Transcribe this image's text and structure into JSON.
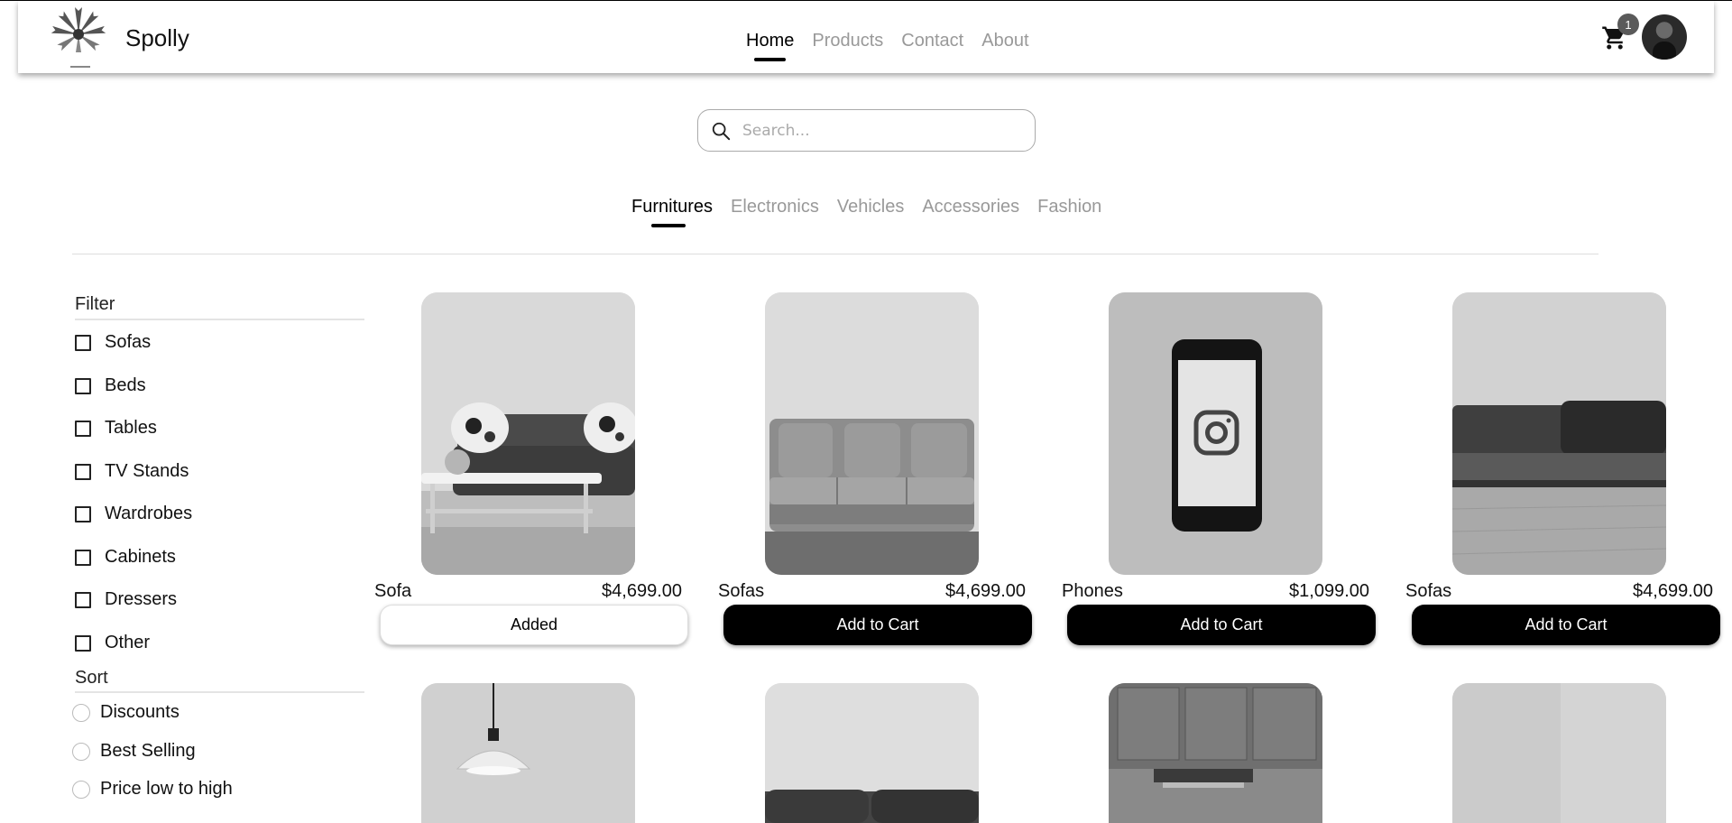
{
  "header": {
    "brand": "Spolly",
    "nav": [
      "Home",
      "Products",
      "Contact",
      "About"
    ],
    "active_nav": "Home",
    "cart_count": "1"
  },
  "search": {
    "placeholder": "Search..."
  },
  "categories": {
    "items": [
      "Furnitures",
      "Electronics",
      "Vehicles",
      "Accessories",
      "Fashion"
    ],
    "active": "Furnitures"
  },
  "sidebar": {
    "filter_title": "Filter",
    "filters": [
      "Sofas",
      "Beds",
      "Tables",
      "TV Stands",
      "Wardrobes",
      "Cabinets",
      "Dressers",
      "Other"
    ],
    "sort_title": "Sort",
    "sort_options": [
      "Discounts",
      "Best Selling",
      "Price low to high"
    ]
  },
  "products": [
    {
      "name": "Sofa",
      "price": "$4,699.00",
      "button": "Added",
      "state": "added",
      "image": "sofa-with-coffee-table"
    },
    {
      "name": "Sofas",
      "price": "$4,699.00",
      "button": "Add to Cart",
      "state": "default",
      "image": "three-seat-sofa"
    },
    {
      "name": "Phones",
      "price": "$1,099.00",
      "button": "Add to Cart",
      "state": "default",
      "image": "smartphone-instagram"
    },
    {
      "name": "Sofas",
      "price": "$4,699.00",
      "button": "Add to Cart",
      "state": "default",
      "image": "low-sofa"
    }
  ],
  "products_row2": [
    {
      "image": "pendant-lamp"
    },
    {
      "image": "sofa-back"
    },
    {
      "image": "kitchen-cabinets"
    },
    {
      "image": "plain-wall"
    }
  ],
  "colors": {
    "accent": "#000000",
    "muted_text": "#999999",
    "badge": "#5a5a5a"
  }
}
